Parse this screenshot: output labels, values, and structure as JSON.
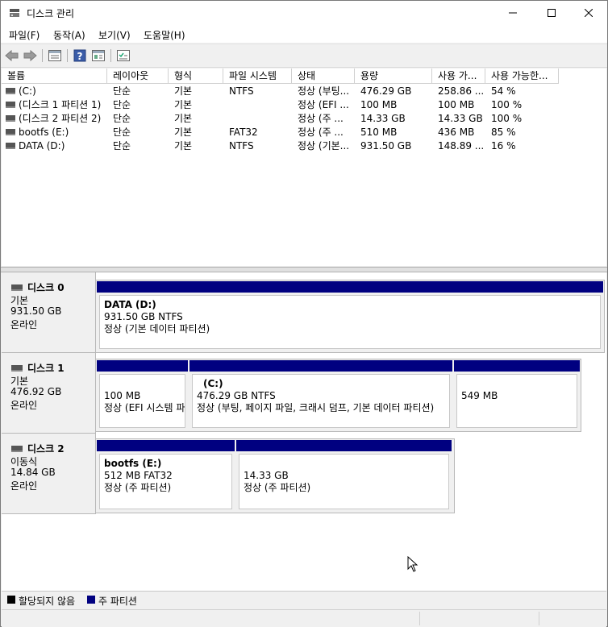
{
  "window": {
    "title": "디스크 관리",
    "app_icon": "disk-management-icon",
    "controls": [
      "minimize-icon",
      "maximize-icon",
      "close-icon"
    ]
  },
  "menu": [
    "파일(F)",
    "동작(A)",
    "보기(V)",
    "도움말(H)"
  ],
  "toolbar": [
    "back-icon",
    "forward-icon",
    "properties-list-icon",
    "help-icon",
    "disk-list-icon",
    "properties-icon"
  ],
  "volume_list": {
    "columns": [
      "볼륨",
      "레이아웃",
      "형식",
      "파일 시스템",
      "상태",
      "용량",
      "사용 가...",
      "사용 가능한..."
    ],
    "rows": [
      [
        "(C:)",
        "단순",
        "기본",
        "NTFS",
        "정상 (부팅...",
        "476.29 GB",
        "258.86 ...",
        "54 %"
      ],
      [
        "(디스크 1 파티션 1)",
        "단순",
        "기본",
        "",
        "정상 (EFI ...",
        "100 MB",
        "100 MB",
        "100 %"
      ],
      [
        "(디스크 2 파티션 2)",
        "단순",
        "기본",
        "",
        "정상 (주 ...",
        "14.33 GB",
        "14.33 GB",
        "100 %"
      ],
      [
        "bootfs (E:)",
        "단순",
        "기본",
        "FAT32",
        "정상 (주 ...",
        "510 MB",
        "436 MB",
        "85 %"
      ],
      [
        "DATA (D:)",
        "단순",
        "기본",
        "NTFS",
        "정상 (기본...",
        "931.50 GB",
        "148.89 ...",
        "16 %"
      ]
    ]
  },
  "disks": [
    {
      "name": "디스크 0",
      "type": "기본",
      "size": "931.50 GB",
      "status": "온라인",
      "partitions": [
        {
          "label": "DATA  (D:)",
          "size": "931.50 GB NTFS",
          "status": "정상 (기본 데이터 파티션)"
        }
      ]
    },
    {
      "name": "디스크 1",
      "type": "기본",
      "size": "476.92 GB",
      "status": "온라인",
      "partitions": [
        {
          "label": "",
          "size": "100 MB",
          "status": "정상 (EFI 시스템 파"
        },
        {
          "label": "(C:)",
          "size": "476.29 GB NTFS",
          "status": "정상 (부팅, 페이지 파일, 크래시 덤프, 기본 데이터 파티션)"
        },
        {
          "label": "",
          "size": "549 MB",
          "status": ""
        }
      ]
    },
    {
      "name": "디스크 2",
      "type": "이동식",
      "size": "14.84 GB",
      "status": "온라인",
      "partitions": [
        {
          "label": "bootfs  (E:)",
          "size": "512 MB FAT32",
          "status": "정상 (주 파티션)"
        },
        {
          "label": "",
          "size": "14.33 GB",
          "status": "정상 (주 파티션)"
        }
      ]
    }
  ],
  "legend": [
    {
      "color": "#000000",
      "label": "할당되지 않음"
    },
    {
      "color": "#000080",
      "label": "주 파티션"
    }
  ],
  "colors": {
    "primary_partition": "#000080",
    "unallocated": "#000000"
  }
}
